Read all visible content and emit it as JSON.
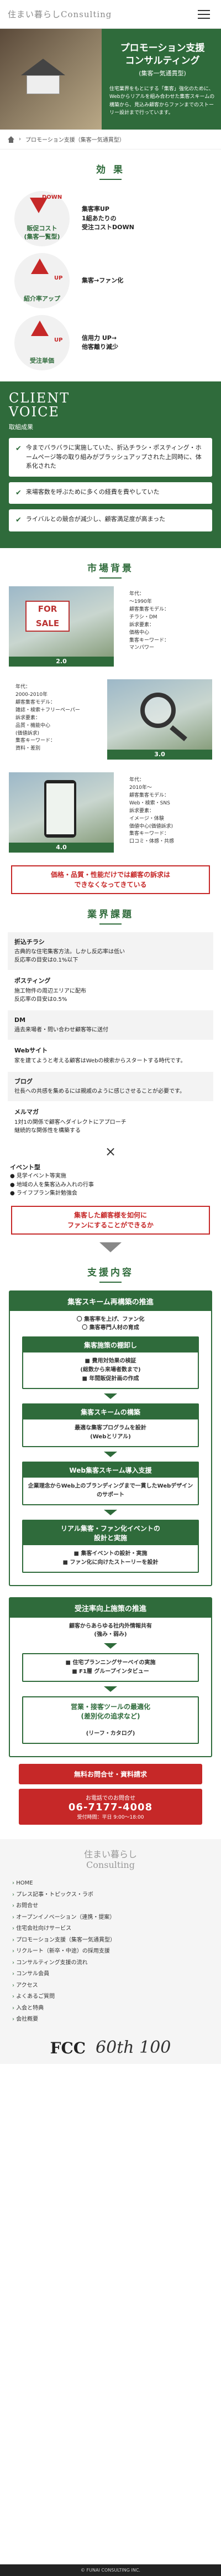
{
  "header": {
    "logo": "住まい暮らしConsulting"
  },
  "hero": {
    "title": "プロモーション支援\nコンサルティング",
    "subtitle": "(集客一気通貫型)",
    "text": "住宅業界をもとにする「集客」強化のために、Webからリアルを組み合わせた集客スキームの構築から、見込み顧客からファンまでのストーリー設計まで行っています。"
  },
  "breadcrumb": {
    "current": "プロモーション支援（集客一気通貫型）"
  },
  "effects": {
    "title": "効 果",
    "items": [
      {
        "label": "badge",
        "circle": "販促コスト\n(集客一覧型)",
        "tag": "DOWN",
        "text": "集客率UP\n1組あたりの\n受注コストDOWN"
      },
      {
        "circle": "紹介率アップ",
        "tag": "UP",
        "text": "集客→ファン化"
      },
      {
        "circle": "受注単価",
        "tag": "UP",
        "text": "信用力 UP→\n他客離り減少"
      }
    ]
  },
  "voice": {
    "title": "CLIENT\nVOICE",
    "subtitle": "取組成果",
    "items": [
      "今までバラバラに実施していた、折込チラシ・ポスティング・ホームページ等の取り組みがブラッシュアップされた上同時に、体系化された",
      "来場客数を呼ぶために多くの経費を費やしていた",
      "ライバルとの競合が減少し、顧客満足度が高まった"
    ]
  },
  "market": {
    "title": "市場背景",
    "rows": [
      {
        "cap": "2.0",
        "info": "年代：\n〜1990年\n顧客集客モデル：\nチラシ・DM\n訴求要素：\n価格中心\n集客キーワード：\nマンパワー",
        "sign": "FOR SALE"
      },
      {
        "cap": "3.0",
        "info": "年代：\n2000-2010年\n顧客集客モデル：\n雑誌・検索＋フリーペーパー\n訴求要素：\n品質・機能中心\n(価値訴求)\n集客キーワード：\n資料・差別"
      },
      {
        "cap": "4.0",
        "info": "年代：\n2010年〜\n顧客集客モデル：\nWeb・検索・SNS\n訴求要素：\nイメージ・体験\n価値中心(価値訴求)\n集客キーワード：\n口コミ・体感・共感"
      }
    ],
    "alert": "価格・品質・性能だけでは顧客の訴求は\nできなくなってきている"
  },
  "tasks": {
    "title": "業界課題",
    "items": [
      {
        "h": "折込チラシ",
        "b": "古典的な住宅集客方法。しかし反応率は低い\n反応率の目安は0.1%以下"
      },
      {
        "h": "ポスティング",
        "b": "施工物件の周辺エリアに配布\n反応率の目安は0.5%"
      },
      {
        "h": "DM",
        "b": "過去来場者・問い合わせ顧客等に送付"
      },
      {
        "h": "Webサイト",
        "b": "家を建てようと考える顧客はWebの検索からスタートする時代です。"
      },
      {
        "h": "ブログ",
        "b": "社長への共感を集めるには親戚のように感じさせることが必要です。"
      },
      {
        "h": "メルマガ",
        "b": "1対1の関係で顧客へダイレクトにアプローチ\n継続的な関係性を構築する"
      }
    ],
    "x": "×",
    "events_title": "イベント型",
    "events": [
      "● 見学イベント等実施",
      "● 地域の人を集客込み入れの行事",
      "● ライフプラン集計勉強会"
    ]
  },
  "alert2": "集客した顧客様を如何に\nファンにすることができるか",
  "support": {
    "title": "支援内容",
    "flow1": {
      "head": "集客スキーム再構築の推進",
      "sub": "〇 集客率を上げ、ファン化\n〇 集客専門人材の育成",
      "boxes": [
        {
          "h": "集客施策の棚卸し",
          "b": "■ 費用対効果の検証\n(総数から来場者数まで)\n■ 年間販促計画の作成"
        },
        {
          "h": "集客スキームの構築",
          "b": "最適な集客プログラムを設計\n(Webとリアル)"
        },
        {
          "h": "Web集客スキーム導入支援",
          "b": "企業理念からWeb上のブランディングまで一貫したWebデザインのサポート"
        },
        {
          "h": "リアル集客・ファン化イベントの\n設計と実施",
          "b": "■ 集客イベントの設計・実施\n■ ファン化に向けたストーリーを設計"
        }
      ]
    },
    "flow2": {
      "head": "受注率向上施策の推進",
      "sub": "顧客からあらゆる社内外情報共有\n(強み・弱み)",
      "boxes": [
        {
          "h": "",
          "b": "■ 住宅プランニングサーベイの実施\n■ F1層 グループインタビュー"
        },
        {
          "h": "営業・接客ツールの最適化\n(差別化の追求など)",
          "b": "(リーフ・カタログ)"
        }
      ]
    }
  },
  "cta": {
    "button": "無料お問合せ・資料請求",
    "tel_top": "お電話でのお問合せ",
    "tel": "06-7177-4008",
    "tel_hours": "受付時間：平日 9:00〜18:00"
  },
  "footer": {
    "logo": "住まい暮らし\nConsulting",
    "links": [
      "HOME",
      "プレス記事・トピックス・ラボ",
      "お問合せ",
      "オープンイノベーション（連携・提案）",
      "住宅会社向けサービス",
      "プロモーション支援（集客一気通貫型）",
      "リクルート（新卒・中途）の採用支援",
      "コンサルティング支援の流れ",
      "コンサル会員",
      "アクセス",
      "よくあるご質問",
      "入会と特典",
      "会社概要"
    ],
    "fcc": "FCC",
    "anniversary": "60th 100",
    "copy": "© FUNAI CONSULTING INC."
  }
}
